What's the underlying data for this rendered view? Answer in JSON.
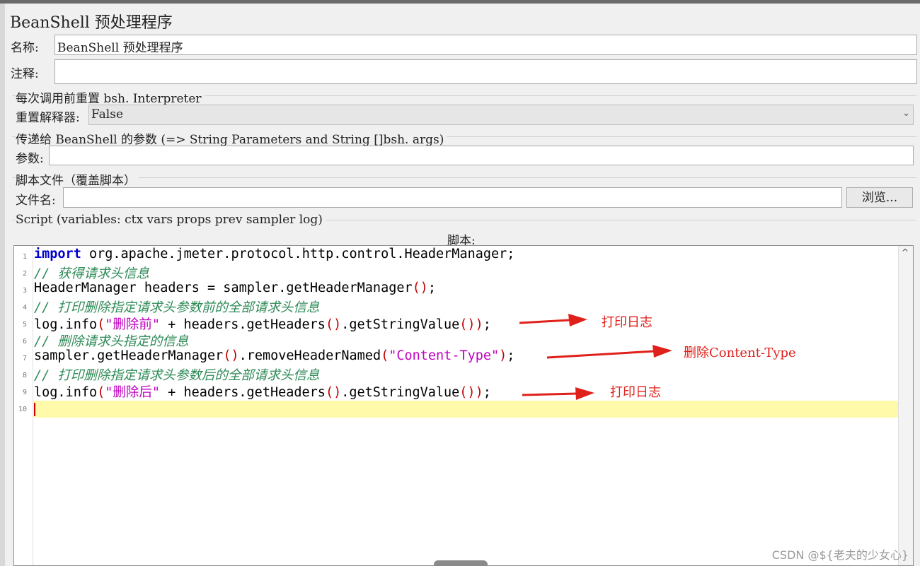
{
  "title": "BeanShell 预处理程序",
  "name_field": {
    "label": "名称:",
    "value": "BeanShell 预处理程序"
  },
  "comment_field": {
    "label": "注释:",
    "value": ""
  },
  "reset_group": {
    "title": "每次调用前重置 bsh. Interpreter",
    "label": "重置解释器:",
    "value": "False"
  },
  "params_group": {
    "title": "传递给 BeanShell 的参数 (=> String Parameters and String []bsh. args)",
    "label": "参数:",
    "value": ""
  },
  "file_group": {
    "title": "脚本文件（覆盖脚本）",
    "label": "文件名:",
    "value": "",
    "browse_label": "浏览..."
  },
  "script_group": {
    "title": "Script (variables: ctx vars props prev sampler log)",
    "header": "脚本:"
  },
  "code": {
    "line_numbers": [
      "1",
      "2",
      "3",
      "4",
      "5",
      "6",
      "7",
      "8",
      "9",
      "10"
    ],
    "l1": {
      "kw": "import",
      "rest": " org.apache.jmeter.protocol.http.control.HeaderManager;"
    },
    "l2": "// 获得请求头信息",
    "l3": {
      "a": "HeaderManager headers = sampler.getHeaderManager",
      "p": "()",
      "b": ";"
    },
    "l4": "// 打印删除指定请求头参数前的全部请求头信息",
    "l5": {
      "a": "log.info",
      "p1": "(",
      "s": "\"删除前\"",
      "b": " + headers.getHeaders",
      "p2": "()",
      "c": ".getStringValue",
      "p3": "())",
      "d": ";"
    },
    "l6": "// 删除请求头指定的信息",
    "l7": {
      "a": "sampler.getHeaderManager",
      "p1": "()",
      "b": ".removeHeaderNamed",
      "p2": "(",
      "s": "\"Content-Type\"",
      "p3": ")",
      "c": ";"
    },
    "l8": "// 打印删除指定请求头参数后的全部请求头信息",
    "l9": {
      "a": "log.info",
      "p1": "(",
      "s": "\"删除后\"",
      "b": " + headers.getHeaders",
      "p2": "()",
      "c": ".getStringValue",
      "p3": "())",
      "d": ";"
    }
  },
  "annotations": {
    "a1": "打印日志",
    "a2": "删除Content-Type",
    "a3": "打印日志"
  },
  "watermark": "CSDN @${老夫的少女心}",
  "colors": {
    "keyword": "#0000cc",
    "comment": "#2e8b57",
    "string": "#c000c0",
    "paren": "#c00000",
    "annotation": "#e0201a",
    "current_line": "#fefaaa"
  }
}
